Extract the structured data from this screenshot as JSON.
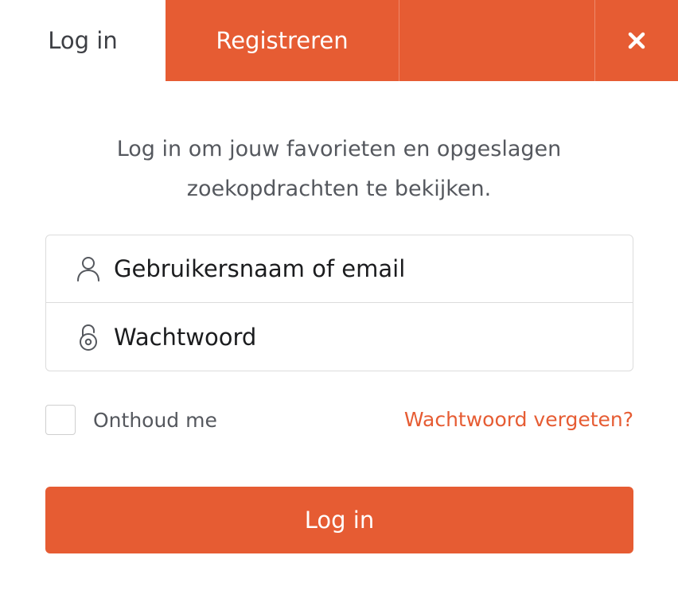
{
  "tabs": {
    "login_label": "Log in",
    "register_label": "Registreren",
    "close_icon": "close-icon"
  },
  "intro": {
    "line1": "Log in om jouw favorieten en opgeslagen",
    "line2": "zoekopdrachten te bekijken."
  },
  "form": {
    "username": {
      "placeholder": "Gebruikersnaam of email",
      "icon": "user-icon",
      "value": ""
    },
    "password": {
      "placeholder": "Wachtwoord",
      "icon": "lock-icon",
      "value": ""
    },
    "remember_label": "Onthoud me",
    "remember_checked": false,
    "forgot_label": "Wachtwoord vergeten?",
    "submit_label": "Log in"
  },
  "colors": {
    "accent": "#e65c33",
    "text": "#55585e",
    "border": "#dcdcdc"
  }
}
